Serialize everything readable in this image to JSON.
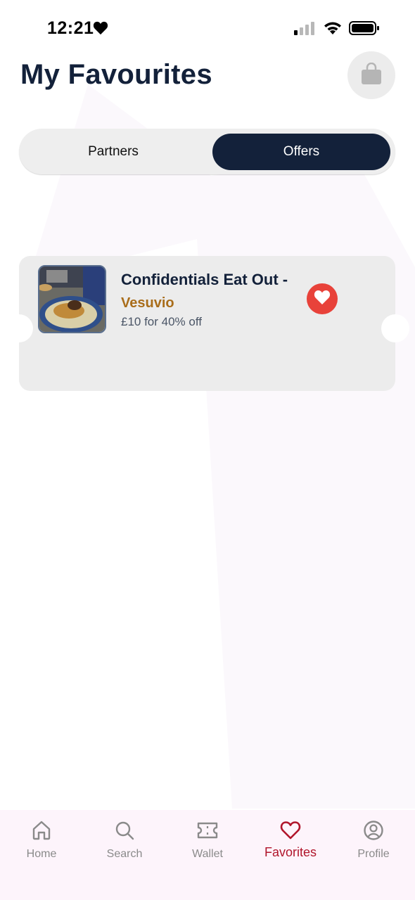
{
  "status_bar": {
    "time": "12:21"
  },
  "header": {
    "title": "My Favourites",
    "bag_icon": "shopping-bag-icon"
  },
  "tabs": [
    {
      "label": "Partners",
      "active": false
    },
    {
      "label": "Offers",
      "active": true
    }
  ],
  "offers": [
    {
      "title": "Confidentials Eat Out -",
      "partner": "Vesuvio",
      "description": "£10 for 40% off",
      "favourited": true
    }
  ],
  "bottom_nav": {
    "items": [
      {
        "label": "Home",
        "icon": "home-icon",
        "active": false
      },
      {
        "label": "Search",
        "icon": "search-icon",
        "active": false
      },
      {
        "label": "Wallet",
        "icon": "ticket-icon",
        "active": false
      },
      {
        "label": "Favorites",
        "icon": "heart-icon",
        "active": true
      },
      {
        "label": "Profile",
        "icon": "user-circle-icon",
        "active": false
      }
    ]
  },
  "colors": {
    "navy": "#13213a",
    "accent_red": "#e8423a",
    "active_nav": "#b0152b",
    "partner_gold": "#a96d1a"
  }
}
